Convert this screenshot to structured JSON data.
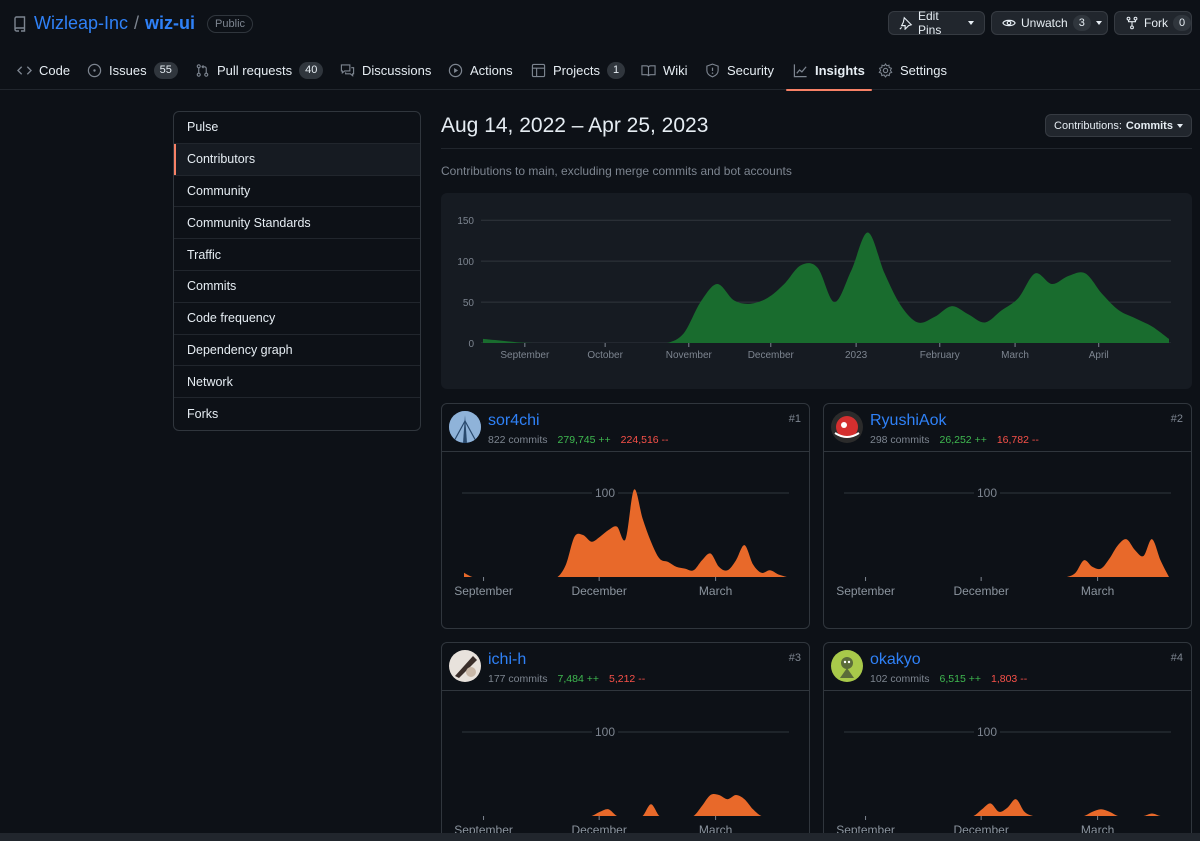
{
  "repo": {
    "owner": "Wizleap-Inc",
    "separator": "/",
    "name": "wiz-ui",
    "visibility": "Public"
  },
  "header_buttons": {
    "edit_pins": "Edit Pins",
    "unwatch": "Unwatch",
    "unwatch_count": "3",
    "fork": "Fork",
    "fork_count": "0"
  },
  "tabs": [
    {
      "label": "Code",
      "icon": "code-icon"
    },
    {
      "label": "Issues",
      "count": "55",
      "icon": "issue-icon"
    },
    {
      "label": "Pull requests",
      "count": "40",
      "icon": "pull-request-icon"
    },
    {
      "label": "Discussions",
      "icon": "discussion-icon"
    },
    {
      "label": "Actions",
      "icon": "play-icon"
    },
    {
      "label": "Projects",
      "count": "1",
      "icon": "table-icon"
    },
    {
      "label": "Wiki",
      "icon": "book-icon"
    },
    {
      "label": "Security",
      "icon": "shield-icon"
    },
    {
      "label": "Insights",
      "icon": "graph-icon",
      "active": true
    },
    {
      "label": "Settings",
      "icon": "gear-icon"
    }
  ],
  "side_menu": [
    "Pulse",
    "Contributors",
    "Community",
    "Community Standards",
    "Traffic",
    "Commits",
    "Code frequency",
    "Dependency graph",
    "Network",
    "Forks"
  ],
  "side_menu_selected": "Contributors",
  "main": {
    "date_range": "Aug 14, 2022 – Apr 25, 2023",
    "contrib_button_prefix": "Contributions:",
    "contrib_button_value": "Commits",
    "subtitle": "Contributions to main, excluding merge commits and bot accounts"
  },
  "colors": {
    "accent": "#f78166",
    "link": "#2f81f7",
    "area_green": "#196c2e",
    "area_orange": "#e8692a",
    "additions": "#3fb950",
    "deletions": "#f85149"
  },
  "chart_data": [
    {
      "type": "area",
      "title": "",
      "y_ticks": [
        0,
        50,
        100,
        150
      ],
      "ylim": [
        0,
        160
      ],
      "x_tick_labels": [
        "September",
        "October",
        "November",
        "December",
        "2023",
        "February",
        "March",
        "April"
      ],
      "x_tick_weeks": [
        2.5,
        7.3,
        12.3,
        17.2,
        22.3,
        27.3,
        31.8,
        36.8
      ],
      "weeks": 42,
      "values": [
        5,
        3,
        1,
        0,
        0,
        0,
        0,
        0,
        0,
        0,
        0,
        0,
        12,
        50,
        72,
        52,
        48,
        55,
        72,
        95,
        92,
        50,
        88,
        135,
        85,
        45,
        25,
        32,
        45,
        35,
        25,
        40,
        55,
        85,
        72,
        82,
        85,
        60,
        40,
        30,
        20,
        5
      ]
    },
    {
      "type": "area",
      "user": "sor4chi",
      "rank": "#1",
      "commits": "822 commits",
      "additions": "279,745 ++",
      "deletions": "224,516 --",
      "y_tick": 100,
      "ylim": [
        0,
        125
      ],
      "x_tick_labels": [
        "September",
        "December",
        "March"
      ],
      "x_tick_weeks": [
        2.3,
        15.9,
        29.6
      ],
      "weeks": 39,
      "values": [
        5,
        0,
        0,
        0,
        0,
        0,
        0,
        0,
        0,
        0,
        0,
        0,
        15,
        48,
        50,
        42,
        48,
        56,
        60,
        45,
        104,
        70,
        42,
        22,
        18,
        12,
        10,
        8,
        20,
        28,
        12,
        8,
        20,
        38,
        15,
        5,
        8,
        3,
        0
      ]
    },
    {
      "type": "area",
      "user": "RyushiAok",
      "rank": "#2",
      "commits": "298 commits",
      "additions": "26,252 ++",
      "deletions": "16,782 --",
      "y_tick": 100,
      "ylim": [
        0,
        125
      ],
      "x_tick_labels": [
        "September",
        "December",
        "March"
      ],
      "x_tick_weeks": [
        2.3,
        15.9,
        29.6
      ],
      "weeks": 39,
      "values": [
        0,
        0,
        0,
        0,
        0,
        0,
        0,
        0,
        0,
        0,
        0,
        0,
        0,
        0,
        0,
        0,
        0,
        0,
        0,
        0,
        0,
        0,
        0,
        0,
        0,
        0,
        0,
        5,
        20,
        12,
        10,
        22,
        38,
        45,
        32,
        25,
        45,
        20,
        0
      ]
    },
    {
      "type": "area",
      "user": "ichi-h",
      "rank": "#3",
      "commits": "177 commits",
      "additions": "7,484 ++",
      "deletions": "5,212 --",
      "y_tick": 100,
      "ylim": [
        0,
        125
      ],
      "x_tick_labels": [
        "September",
        "December",
        "March"
      ],
      "x_tick_weeks": [
        2.3,
        15.9,
        29.6
      ],
      "weeks": 39,
      "values": [
        0,
        0,
        0,
        0,
        0,
        0,
        0,
        0,
        0,
        0,
        0,
        0,
        0,
        0,
        0,
        0,
        5,
        8,
        0,
        0,
        0,
        0,
        14,
        0,
        0,
        0,
        0,
        0,
        12,
        25,
        25,
        20,
        25,
        20,
        8,
        0,
        0,
        0,
        0
      ]
    },
    {
      "type": "area",
      "user": "okakyo",
      "rank": "#4",
      "commits": "102 commits",
      "additions": "6,515 ++",
      "deletions": "1,803 --",
      "y_tick": 100,
      "ylim": [
        0,
        125
      ],
      "x_tick_labels": [
        "September",
        "December",
        "March"
      ],
      "x_tick_weeks": [
        2.3,
        15.9,
        29.6
      ],
      "weeks": 39,
      "values": [
        0,
        0,
        0,
        0,
        0,
        0,
        0,
        0,
        0,
        0,
        0,
        0,
        0,
        0,
        0,
        0,
        8,
        15,
        5,
        10,
        20,
        5,
        0,
        0,
        0,
        0,
        0,
        0,
        0,
        5,
        8,
        5,
        0,
        0,
        0,
        0,
        3,
        0,
        0
      ]
    }
  ]
}
